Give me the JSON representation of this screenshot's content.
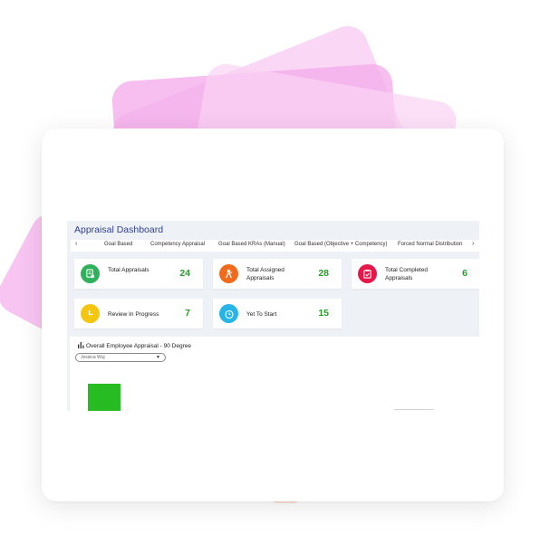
{
  "dashboard": {
    "title": "Appraisal Dashboard",
    "tab_prev": "‹",
    "tab_next": "›",
    "tabs": [
      {
        "label": "Goal Based"
      },
      {
        "label": "Competency Appraisal"
      },
      {
        "label": "Goal Based KRAs (Manual)"
      },
      {
        "label": "Goal Based (Objective + Competency)"
      },
      {
        "label": "Forced Normal Distribution"
      }
    ],
    "tiles": [
      {
        "label": "Total Appraisals",
        "value": "24",
        "color": "#2eb15a",
        "icon": "appraisal-doc-icon"
      },
      {
        "label": "Total Assigned Appraisals",
        "value": "28",
        "color": "#f26b1d",
        "icon": "person-assign-icon"
      },
      {
        "label": "Total Completed Appraisals",
        "value": "6",
        "color": "#e8174a",
        "icon": "clipboard-check-icon"
      },
      {
        "label": "Review In Progress",
        "value": "7",
        "color": "#f5c60f",
        "icon": "clock-icon"
      },
      {
        "label": "Yet To Start",
        "value": "15",
        "color": "#26b5e6",
        "icon": "alarm-clock-icon"
      }
    ],
    "panel": {
      "title": "Overall Employee Appraisal - 90 Degree",
      "employee_select": "Jessica Wuj",
      "bar_color": "#27bd22"
    }
  }
}
